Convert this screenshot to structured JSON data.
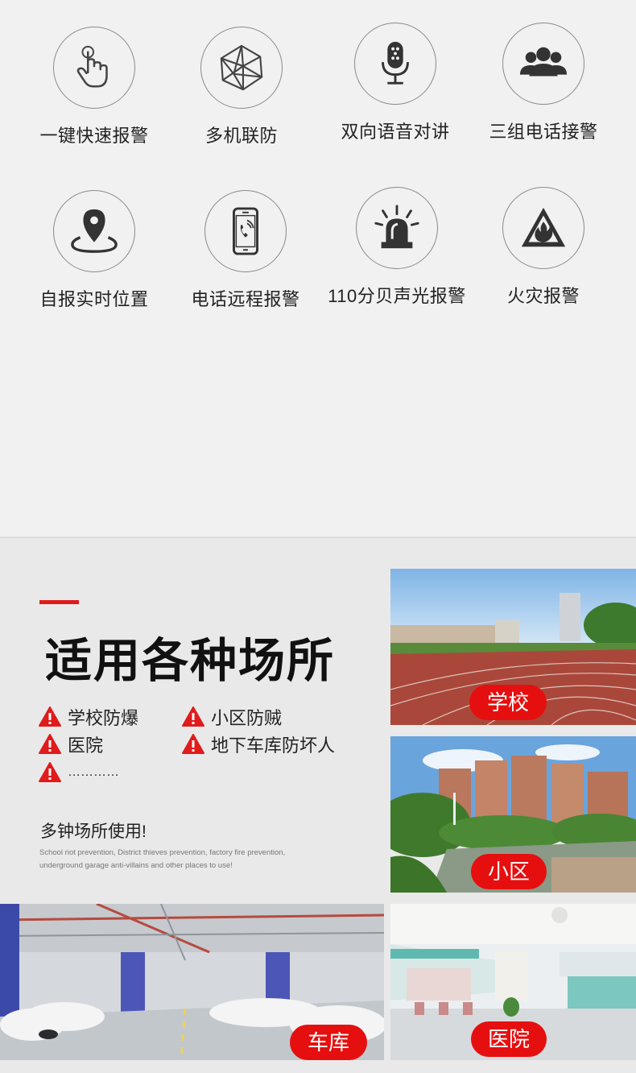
{
  "features": [
    {
      "label": "一键快速报警",
      "icon": "finger-press-icon"
    },
    {
      "label": "多机联防",
      "icon": "network-polyhedron-icon"
    },
    {
      "label": "双向语音对讲",
      "icon": "microphone-icon"
    },
    {
      "label": "三组电话接警",
      "icon": "user-group-icon"
    },
    {
      "label": "自报实时位置",
      "icon": "location-pin-icon"
    },
    {
      "label": "电话远程报警",
      "icon": "mobile-phone-icon"
    },
    {
      "label": "110分贝声光报警",
      "icon": "alarm-siren-icon"
    },
    {
      "label": "火灾报警",
      "icon": "fire-warning-icon"
    }
  ],
  "places": {
    "title": "适用各种场所",
    "items": [
      "学校防爆",
      "小区防贼",
      "医院",
      "地下车库防坏人",
      "…………"
    ],
    "subtitle": "多钟场所使用!",
    "description": "School riot prevention, District thieves prevention, factory fire prevention, underground garage anti-villains and other places to use!",
    "photos": [
      {
        "tag": "学校"
      },
      {
        "tag": "小区"
      },
      {
        "tag": "车库"
      },
      {
        "tag": "医院"
      }
    ]
  },
  "colors": {
    "accent": "#e60f0f",
    "background": "#f1f1f1",
    "icon_stroke": "#444444"
  }
}
